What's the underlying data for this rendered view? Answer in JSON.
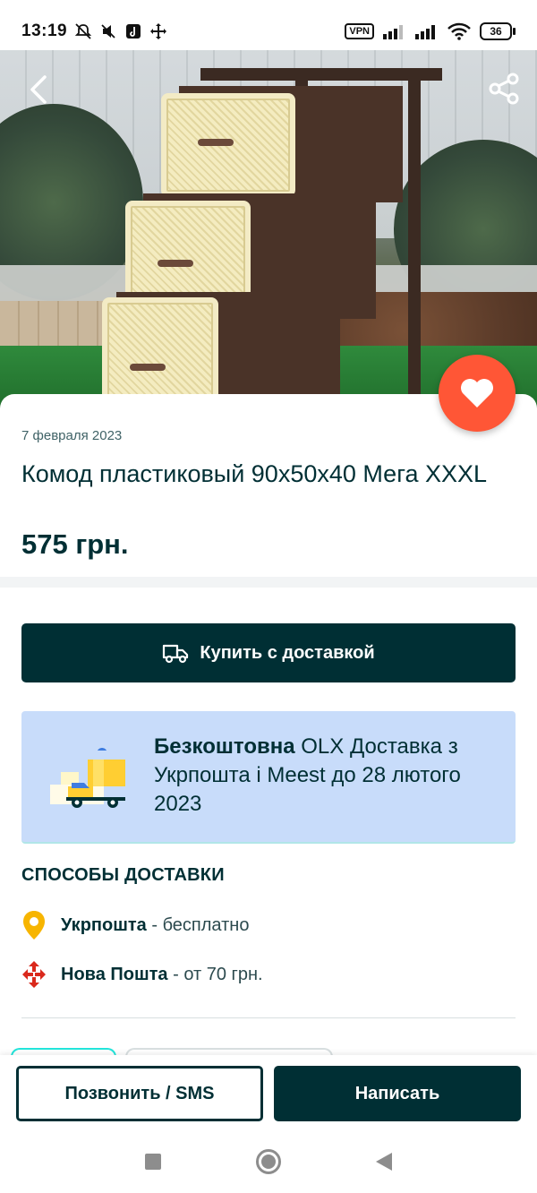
{
  "status_bar": {
    "time": "13:19",
    "vpn_label": "VPN",
    "battery": "36",
    "icons": [
      "dnd-icon",
      "mute-icon",
      "tiktok-icon",
      "move-icon",
      "signal-icon",
      "signal-icon",
      "wifi-icon",
      "battery-icon"
    ]
  },
  "gallery": {
    "image_count": 3,
    "active_index": 0,
    "back_icon": "chevron-left-icon",
    "share_icon": "share-icon",
    "favorite_icon": "heart-icon"
  },
  "listing": {
    "date": "7 февраля 2023",
    "title": "Комод пластиковый 90x50x40 Мега XXXL",
    "price": "575 грн."
  },
  "buy_button": {
    "label": "Купить с доставкой",
    "icon": "truck-icon"
  },
  "promo": {
    "bold": "Безкоштовна",
    "text": " OLX Доставка з Укрпошта і Meest до 28 лютого 2023"
  },
  "delivery": {
    "heading": "СПОСОБЫ ДОСТАВКИ",
    "methods": [
      {
        "name": "Укрпошта",
        "detail": " - бесплатно",
        "icon": "ukrposhta-icon"
      },
      {
        "name": "Нова Пошта",
        "detail": " - от 70 грн.",
        "icon": "nova-poshta-icon"
      }
    ]
  },
  "actions": {
    "call_label": "Позвонить / SMS",
    "write_label": "Написать"
  },
  "colors": {
    "primary": "#002f34",
    "favorite": "#ff5636",
    "promo_bg": "#c8dcfa",
    "accent_teal": "#23e5db"
  }
}
